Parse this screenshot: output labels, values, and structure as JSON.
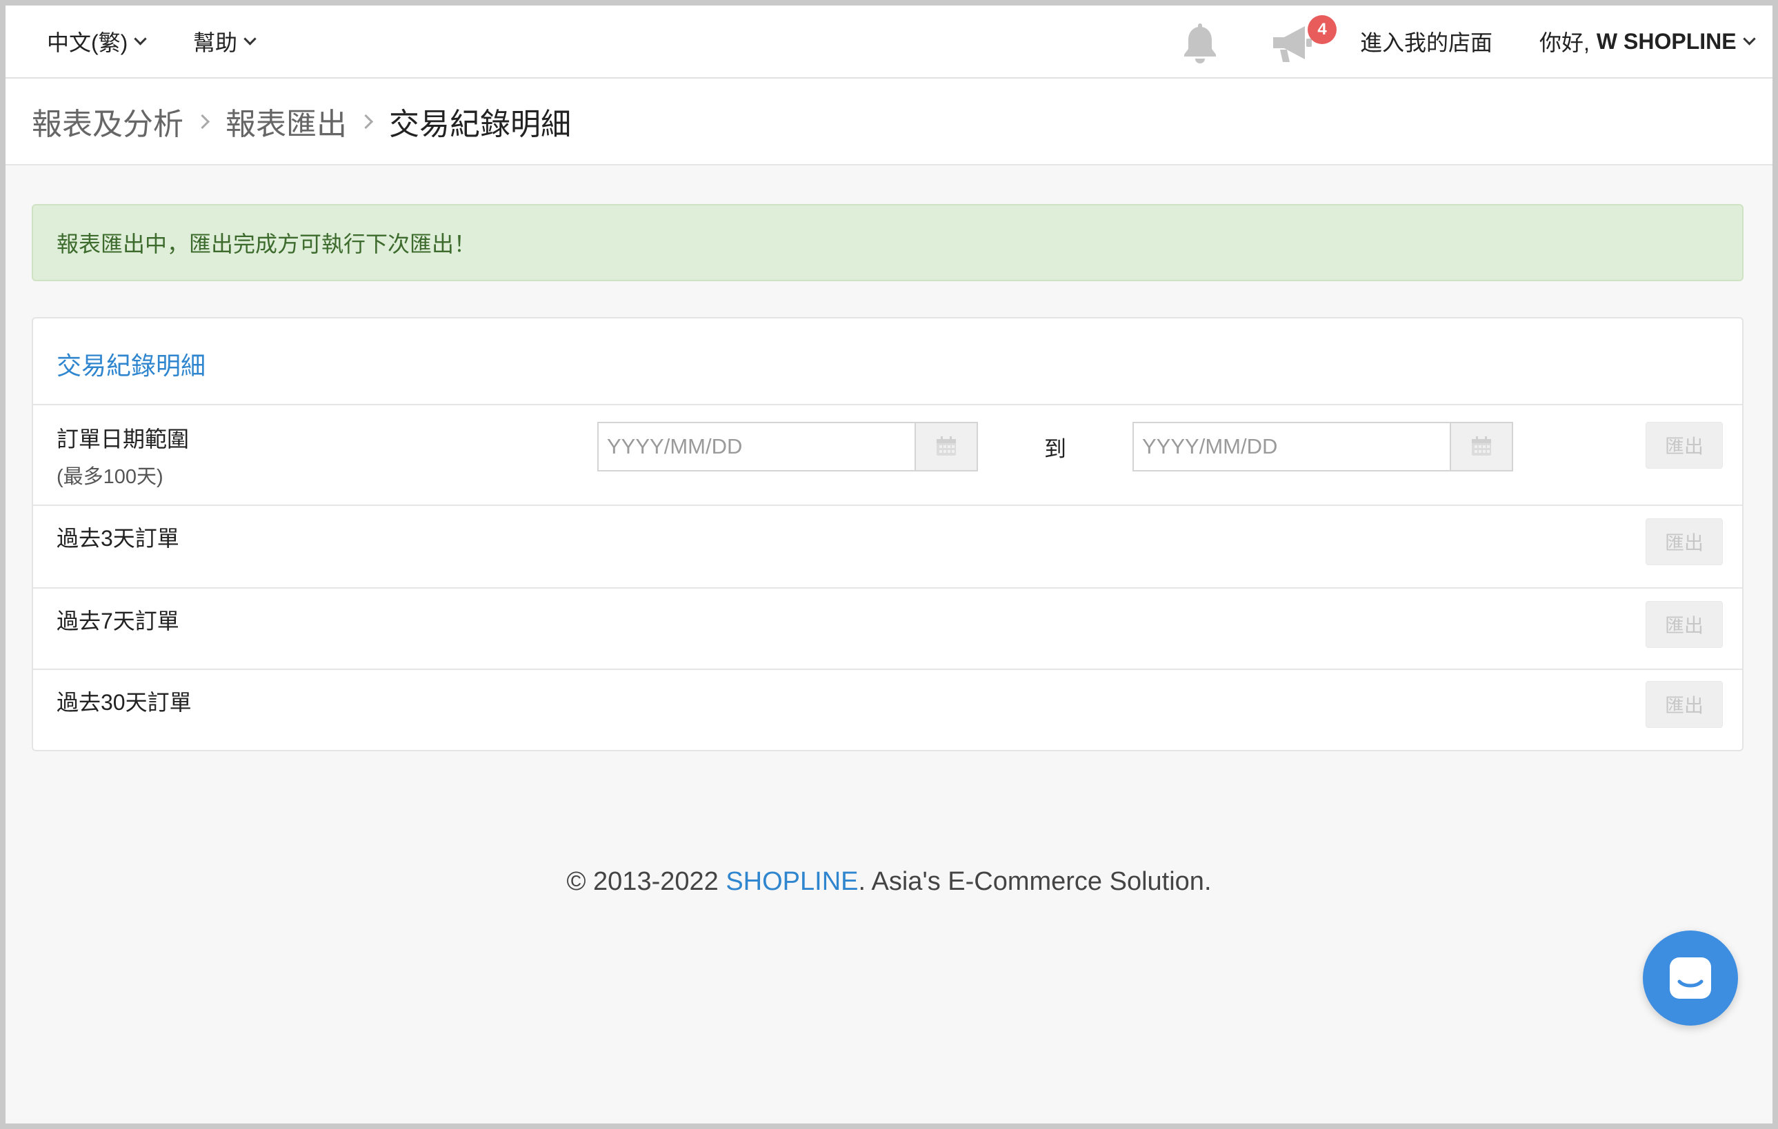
{
  "navbar": {
    "language": "中文(繁)",
    "help": "幫助",
    "notification_count": "4",
    "storefront": "進入我的店面",
    "greeting": "你好,",
    "user_name": "W SHOPLINE"
  },
  "breadcrumb": {
    "items": [
      "報表及分析",
      "報表匯出"
    ],
    "current": "交易紀錄明細"
  },
  "alert": {
    "message": "報表匯出中，匯出完成方可執行下次匯出！",
    "color": "#dfeed8"
  },
  "panel": {
    "title": "交易紀錄明細",
    "date_range": {
      "label": "訂單日期範圍",
      "note": "(最多100天)",
      "from_placeholder": "YYYY/MM/DD",
      "to_label": "到",
      "to_placeholder": "YYYY/MM/DD"
    },
    "rows": [
      {
        "label": "過去3天訂單"
      },
      {
        "label": "過去7天訂單"
      },
      {
        "label": "過去30天訂單"
      }
    ],
    "export_label": "匯出"
  },
  "footer": {
    "prefix": "© 2013-2022 ",
    "brand": "SHOPLINE",
    "suffix": ". Asia's E-Commerce Solution."
  },
  "icons": {
    "bell": "bell-icon",
    "megaphone": "megaphone-icon",
    "calendar": "calendar-icon",
    "chat": "chat-icon"
  },
  "colors": {
    "accent": "#2f86cf",
    "badge": "#e85c5c",
    "chat": "#3d8de0",
    "alert_text": "#3d6b2d"
  }
}
